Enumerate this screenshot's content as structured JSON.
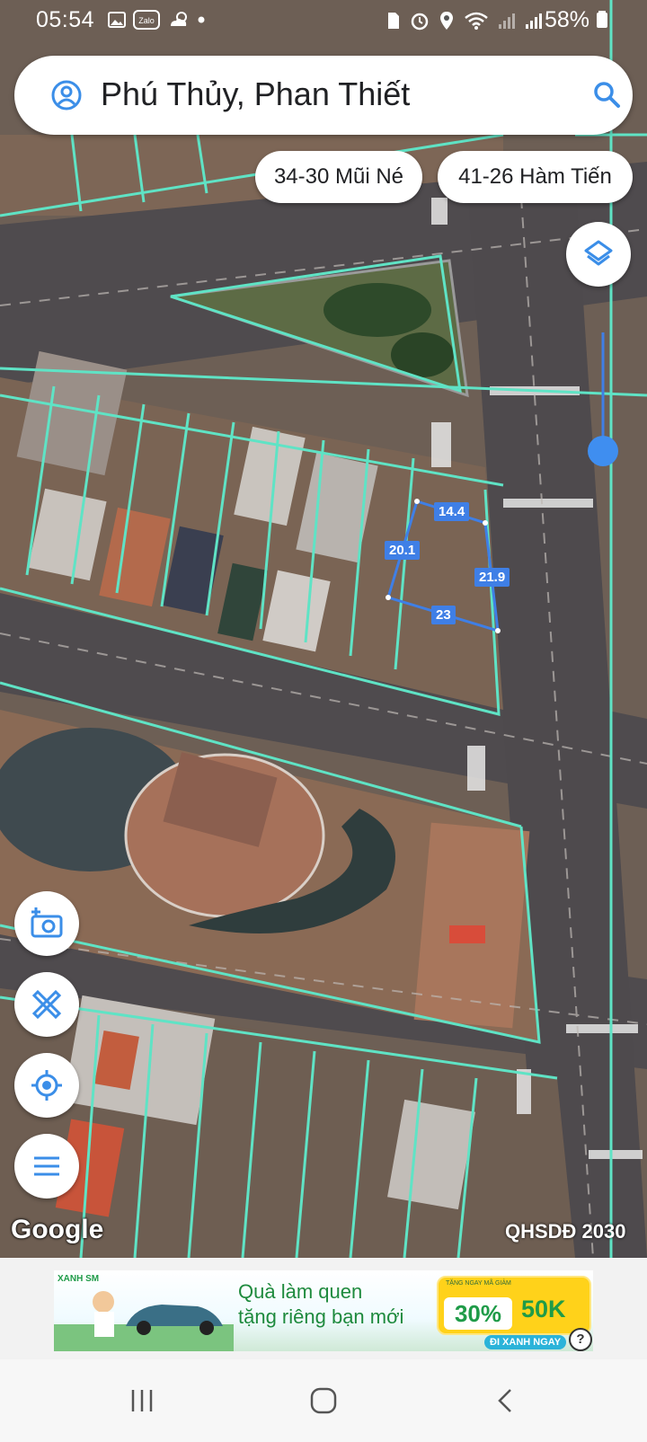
{
  "status_bar": {
    "time": "05:54",
    "battery": "58%",
    "left_icons": [
      "gallery-icon",
      "zalo-icon",
      "weather-icon",
      "dot-icon"
    ],
    "right_icons": [
      "sim-icon",
      "alarm-icon",
      "location-icon",
      "wifi-icon",
      "signal-icon",
      "signal-icon"
    ]
  },
  "search": {
    "title": "Phú Thủy, Phan Thiết",
    "account_icon": "account-icon",
    "search_icon": "search-icon"
  },
  "chips": [
    "34-30 Mũi Né",
    "41-26 Hàm Tiến"
  ],
  "map": {
    "brand": "Google",
    "planning_label": "QHSDĐ 2030",
    "measurements": [
      "14.4",
      "20.1",
      "21.9",
      "23"
    ],
    "colors": {
      "parcel_lines": "#5fe3c5",
      "measure": "#3f7fe6",
      "road": "#4e4a4d"
    }
  },
  "controls": {
    "layers": "layers-icon",
    "camera": "camera-plus-icon",
    "measure": "ruler-pencil-icon",
    "locate": "locate-icon",
    "menu": "menu-icon"
  },
  "ad": {
    "brand": "XANH SM",
    "headline_1": "Quà làm quen",
    "headline_2": "tặng riêng bạn mới",
    "promo_small": "TẶNG NGAY MÃ GIẢM",
    "promo_pct": "30%",
    "promo_amount": "50K",
    "cta": "ĐI XANH NGAY",
    "help": "?"
  },
  "navbar": [
    "recents-icon",
    "home-icon",
    "back-icon"
  ]
}
